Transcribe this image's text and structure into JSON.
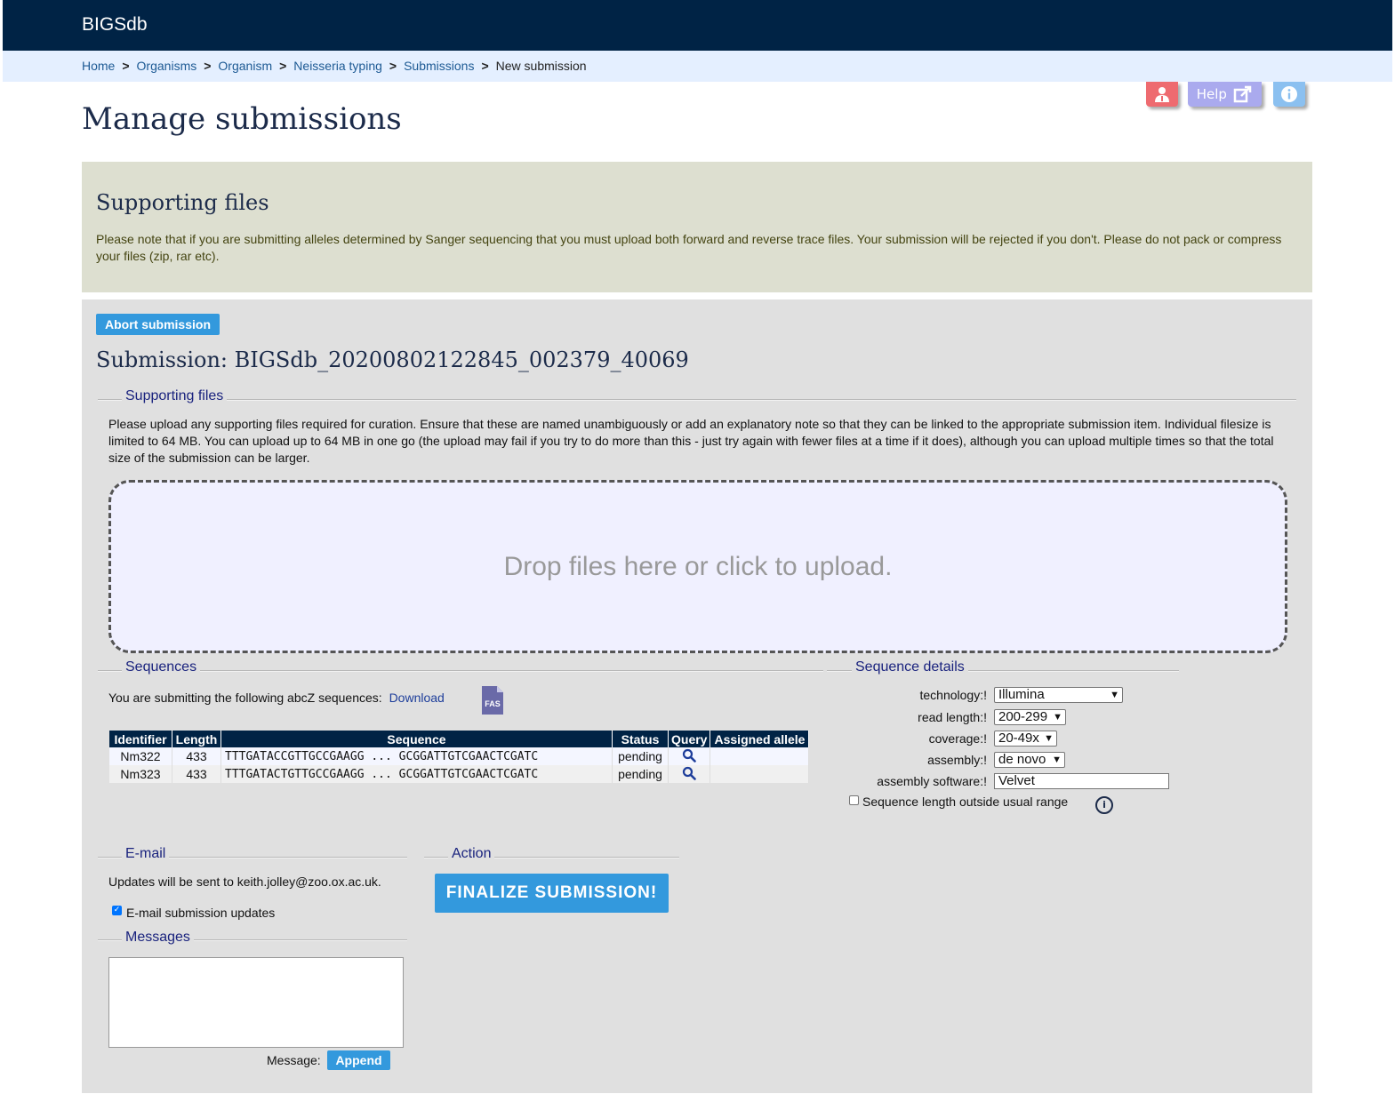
{
  "app": {
    "brand": "BIGSdb"
  },
  "breadcrumb": [
    {
      "label": "Home"
    },
    {
      "label": "Organisms"
    },
    {
      "label": "Organism"
    },
    {
      "label": "Neisseria typing"
    },
    {
      "label": "Submissions"
    },
    {
      "label": "New submission"
    }
  ],
  "toolbar": {
    "help_label": "Help"
  },
  "page": {
    "title": "Manage submissions"
  },
  "info": {
    "heading": "Supporting files",
    "text": "Please note that if you are submitting alleles determined by Sanger sequencing that you must upload both forward and reverse trace files. Your submission will be rejected if you don't. Please do not pack or compress your files (zip, rar etc)."
  },
  "submission": {
    "abort_label": "Abort submission",
    "title": "Submission: BIGSdb_20200802122845_002379_40069"
  },
  "supporting_files": {
    "legend": "Supporting files",
    "text": "Please upload any supporting files required for curation. Ensure that these are named unambiguously or add an explanatory note so that they can be linked to the appropriate submission item. Individual filesize is limited to 64 MB. You can upload up to 64 MB in one go (the upload may fail if you try to do more than this - just try again with fewer files at a time if it does), although you can upload multiple times so that the total size of the submission can be larger.",
    "dropzone": "Drop files here or click to upload."
  },
  "sequences": {
    "legend": "Sequences",
    "intro": "You are submitting the following abcZ sequences:",
    "download_label": "Download",
    "fas_label": "FAS",
    "columns": [
      "Identifier",
      "Length",
      "Sequence",
      "Status",
      "Query",
      "Assigned allele"
    ],
    "rows": [
      {
        "id": "Nm322",
        "length": "433",
        "sequence": "TTTGATACCGTTGCCGAAGG ... GCGGATTGTCGAACTCGATC",
        "status": "pending",
        "assigned": ""
      },
      {
        "id": "Nm323",
        "length": "433",
        "sequence": "TTTGATACTGTTGCCGAAGG ... GCGGATTGTCGAACTCGATC",
        "status": "pending",
        "assigned": ""
      }
    ]
  },
  "details": {
    "legend": "Sequence details",
    "technology_label": "technology:!",
    "technology_value": "Illumina",
    "read_length_label": "read length:!",
    "read_length_value": "200-299",
    "coverage_label": "coverage:!",
    "coverage_value": "20-49x",
    "assembly_label": "assembly:!",
    "assembly_value": "de novo",
    "software_label": "assembly software:!",
    "software_value": "Velvet",
    "outside_range_label": "Sequence length outside usual range"
  },
  "email": {
    "legend": "E-mail",
    "text": "Updates will be sent to keith.jolley@zoo.ox.ac.uk.",
    "checkbox_label": "E-mail submission updates",
    "checked": true
  },
  "action": {
    "legend": "Action",
    "finalize_label": "FINALIZE SUBMISSION!"
  },
  "messages": {
    "legend": "Messages",
    "message_label": "Message:",
    "append_label": "Append"
  },
  "colors": {
    "navy": "#002345",
    "accent": "#3399dd",
    "crumb_bg": "#e4efff",
    "info_bg": "#dddfd0",
    "panel_bg": "#e0e0e0"
  }
}
